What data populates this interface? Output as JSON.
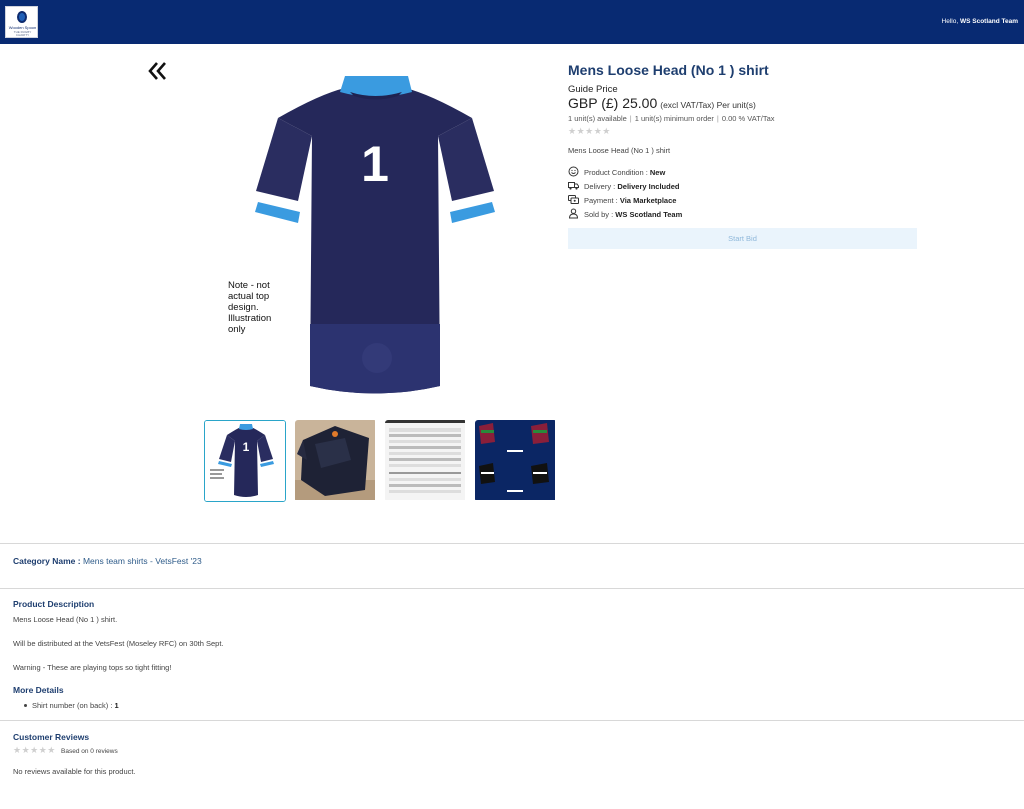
{
  "header": {
    "logo_text": "Wooden Spoon",
    "logo_subtext": "THE RUGBY CHARITY",
    "greeting_prefix": "Hello,",
    "greeting_user": "WS Scotland Team"
  },
  "gallery": {
    "main_image_number": "1",
    "main_image_note": "Note - not actual top design. Illustration only",
    "thumbnails": [
      {
        "label": "shirt-front-illustration",
        "active": true
      },
      {
        "label": "shirt-photo",
        "active": false
      },
      {
        "label": "sizing-table",
        "active": false
      },
      {
        "label": "team-shirt-designs",
        "active": false
      }
    ]
  },
  "product": {
    "title": "Mens Loose Head (No 1 ) shirt",
    "guide_label": "Guide Price",
    "price": "GBP (£) 25.00",
    "price_note": "(excl VAT/Tax) Per unit(s)",
    "units_available": "1 unit(s) available",
    "min_order": "1 unit(s) minimum order",
    "vat": "0.00 % VAT/Tax",
    "rating_stars": "★★★★★",
    "rating_value": 0,
    "short_description": "Mens Loose Head (No 1 ) shirt",
    "attributes": {
      "condition_label": "Product Condition :",
      "condition_value": "New",
      "delivery_label": "Delivery :",
      "delivery_value": "Delivery Included",
      "payment_label": "Payment :",
      "payment_value": "Via Marketplace",
      "seller_label": "Sold by :",
      "seller_value": "WS Scotland Team"
    },
    "start_bid_label": "Start Bid"
  },
  "category": {
    "label": "Category Name :",
    "value": "Mens team shirts - VetsFest '23"
  },
  "description": {
    "title": "Product Description",
    "line1": "Mens Loose Head (No 1 ) shirt.",
    "line2": "Will be distributed at the VetsFest (Moseley RFC) on 30th Sept.",
    "line3": "Warning - These are playing tops so tight fitting!"
  },
  "more_details": {
    "title": "More Details",
    "item_label": "Shirt number (on back) :",
    "item_value": "1"
  },
  "reviews": {
    "title": "Customer Reviews",
    "stars": "★★★★★",
    "basis": "Based on 0 reviews",
    "empty_text": "No reviews available for this product."
  },
  "colors": {
    "header_bg": "#082a72",
    "title_color": "#1e3e6f",
    "shirt_navy": "#25285a",
    "collar_blue": "#3a9be0",
    "active_thumb_border": "#2aa5c9",
    "bid_button_bg": "#eaf4fc"
  }
}
